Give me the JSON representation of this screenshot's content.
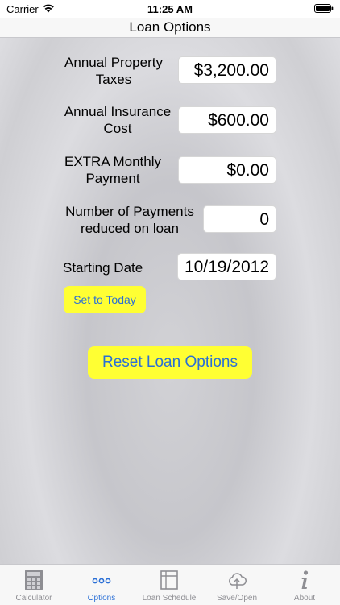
{
  "status_bar": {
    "carrier": "Carrier",
    "time": "11:25 AM"
  },
  "nav": {
    "title": "Loan Options"
  },
  "form": {
    "property_taxes": {
      "label": "Annual Property\nTaxes",
      "value": "$3,200.00"
    },
    "insurance_cost": {
      "label": "Annual Insurance\nCost",
      "value": "$600.00"
    },
    "extra_payment": {
      "label": "EXTRA Monthly\nPayment",
      "value": "$0.00"
    },
    "payments_reduced": {
      "label": "Number of Payments\nreduced on loan",
      "value": "0"
    },
    "starting_date": {
      "label": "Starting Date",
      "value": "10/19/2012"
    },
    "set_today_label": "Set to Today",
    "reset_label": "Reset Loan Options"
  },
  "colors": {
    "button_yellow": "#ffff33",
    "button_text_blue": "#2a6fd6",
    "tab_active": "#2a6fd6",
    "tab_inactive": "#8e8e93"
  },
  "tabs": [
    {
      "label": "Calculator",
      "icon": "calculator-icon",
      "active": false
    },
    {
      "label": "Options",
      "icon": "ellipsis-icon",
      "active": true
    },
    {
      "label": "Loan Schedule",
      "icon": "schedule-grid-icon",
      "active": false
    },
    {
      "label": "Save/Open",
      "icon": "cloud-upload-icon",
      "active": false
    },
    {
      "label": "About",
      "icon": "info-icon",
      "active": false
    }
  ]
}
